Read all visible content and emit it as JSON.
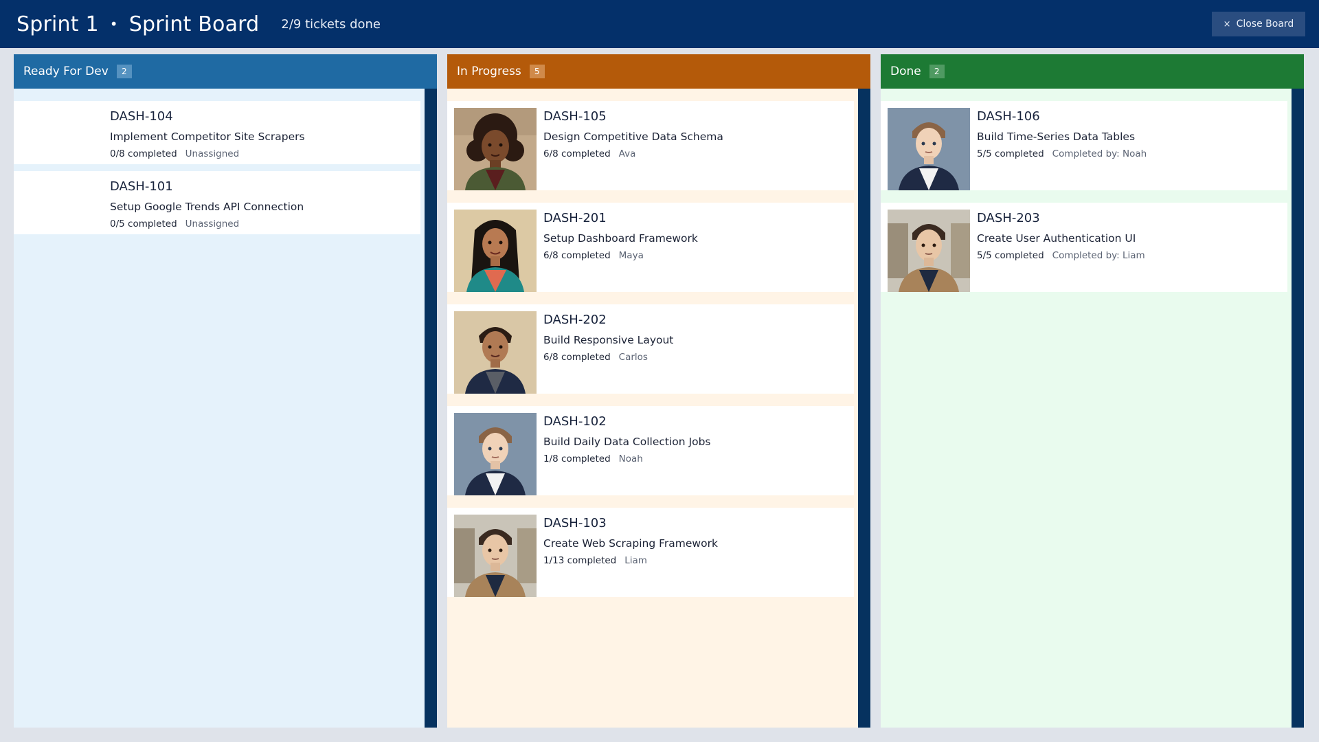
{
  "header": {
    "sprint": "Sprint 1",
    "separator": "•",
    "board_name": "Sprint Board",
    "progress": "2/9 tickets done",
    "close_label": "Close Board",
    "close_icon": "×"
  },
  "colors": {
    "topbar": "#04306a",
    "ready_header": "#1f6aa3",
    "ready_bg": "#e5f2fb",
    "progress_header": "#b45a0a",
    "progress_bg": "#fff4e6",
    "done_header": "#1d7a34",
    "done_bg": "#e9fbee"
  },
  "columns": [
    {
      "name": "Ready For Dev",
      "count": "2",
      "cards": [
        {
          "id": "DASH-104",
          "title": "Implement Competitor Site Scrapers",
          "completed": "0/8 completed",
          "assignee": "Unassigned",
          "avatar": "none"
        },
        {
          "id": "DASH-101",
          "title": "Setup Google Trends API Connection",
          "completed": "0/5 completed",
          "assignee": "Unassigned",
          "avatar": "none"
        }
      ]
    },
    {
      "name": "In Progress",
      "count": "5",
      "cards": [
        {
          "id": "DASH-105",
          "title": "Design Competitive Data Schema",
          "completed": "6/8 completed",
          "assignee": "Ava",
          "avatar": "ava-portrait"
        },
        {
          "id": "DASH-201",
          "title": "Setup Dashboard Framework",
          "completed": "6/8 completed",
          "assignee": "Maya",
          "avatar": "maya-portrait"
        },
        {
          "id": "DASH-202",
          "title": "Build Responsive Layout",
          "completed": "6/8 completed",
          "assignee": "Carlos",
          "avatar": "carlos-portrait"
        },
        {
          "id": "DASH-102",
          "title": "Build Daily Data Collection Jobs",
          "completed": "1/8 completed",
          "assignee": "Noah",
          "avatar": "noah-portrait"
        },
        {
          "id": "DASH-103",
          "title": "Create Web Scraping Framework",
          "completed": "1/13 completed",
          "assignee": "Liam",
          "avatar": "liam-portrait"
        }
      ]
    },
    {
      "name": "Done",
      "count": "2",
      "cards": [
        {
          "id": "DASH-106",
          "title": "Build Time-Series Data Tables",
          "completed": "5/5 completed",
          "assignee": "Completed by: Noah",
          "avatar": "noah-portrait"
        },
        {
          "id": "DASH-203",
          "title": "Create User Authentication UI",
          "completed": "5/5 completed",
          "assignee": "Completed by: Liam",
          "avatar": "liam-portrait"
        }
      ]
    }
  ]
}
